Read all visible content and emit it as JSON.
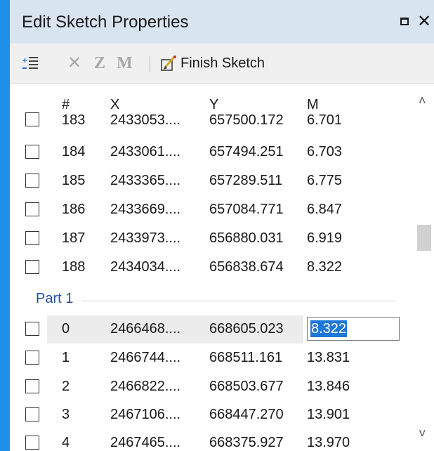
{
  "window": {
    "title": "Edit Sketch Properties"
  },
  "toolbar": {
    "z_label": "Z",
    "m_label": "M",
    "finish_label": "Finish Sketch"
  },
  "grid": {
    "headers": {
      "num": "#",
      "x": "X",
      "y": "Y",
      "m": "M"
    },
    "part_label": "Part 1",
    "rows_part0": [
      {
        "num": "183",
        "x": "2433053....",
        "y": "657500.172",
        "m": "6.701"
      },
      {
        "num": "184",
        "x": "2433061....",
        "y": "657494.251",
        "m": "6.703"
      },
      {
        "num": "185",
        "x": "2433365....",
        "y": "657289.511",
        "m": "6.775"
      },
      {
        "num": "186",
        "x": "2433669....",
        "y": "657084.771",
        "m": "6.847"
      },
      {
        "num": "187",
        "x": "2433973....",
        "y": "656880.031",
        "m": "6.919"
      },
      {
        "num": "188",
        "x": "2434034....",
        "y": "656838.674",
        "m": "8.322"
      }
    ],
    "rows_part1": [
      {
        "num": "0",
        "x": "2466468....",
        "y": "668605.023",
        "m": "8.322"
      },
      {
        "num": "1",
        "x": "2466744....",
        "y": "668511.161",
        "m": "13.831"
      },
      {
        "num": "2",
        "x": "2466822....",
        "y": "668503.677",
        "m": "13.846"
      },
      {
        "num": "3",
        "x": "2467106....",
        "y": "668447.270",
        "m": "13.901"
      },
      {
        "num": "4",
        "x": "2467465....",
        "y": "668375.927",
        "m": "13.970"
      }
    ]
  }
}
